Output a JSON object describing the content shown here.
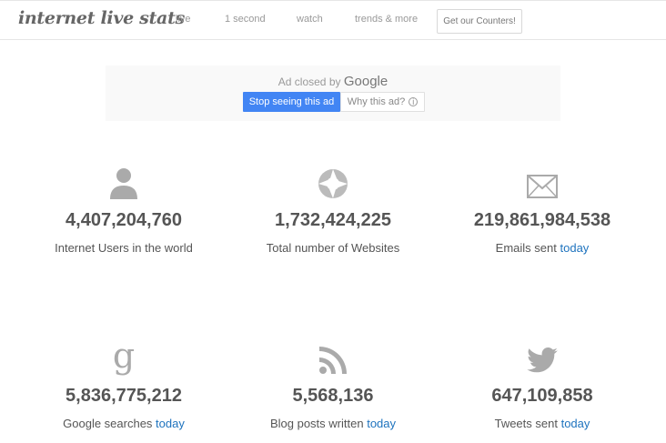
{
  "header": {
    "logo": "internet live stats",
    "nav": [
      "live",
      "1 second",
      "watch",
      "trends & more"
    ],
    "cta_label": "Get our Counters!"
  },
  "ad": {
    "closed_by": "Ad closed by",
    "google": "Google",
    "stop_label": "Stop seeing this ad",
    "why_label": "Why this ad?",
    "info_glyph": "i"
  },
  "stats": [
    {
      "value": "4,407,204,760",
      "label": "Internet Users in the world",
      "today": "",
      "icon": "user-icon"
    },
    {
      "value": "1,732,424,225",
      "label": "Total number of Websites",
      "today": "",
      "icon": "globe-icon"
    },
    {
      "value": "219,861,984,538",
      "label": "Emails sent",
      "today": "today",
      "icon": "mail-icon"
    },
    {
      "value": "5,836,775,212",
      "label": "Google searches",
      "today": "today",
      "icon": "google-icon"
    },
    {
      "value": "5,568,136",
      "label": "Blog posts written",
      "today": "today",
      "icon": "rss-icon"
    },
    {
      "value": "647,109,858",
      "label": "Tweets sent",
      "today": "today",
      "icon": "twitter-icon"
    }
  ],
  "colors": {
    "link": "#1e73be",
    "ad_button": "#4285f4",
    "icon_gray": "#aaaaaa"
  }
}
